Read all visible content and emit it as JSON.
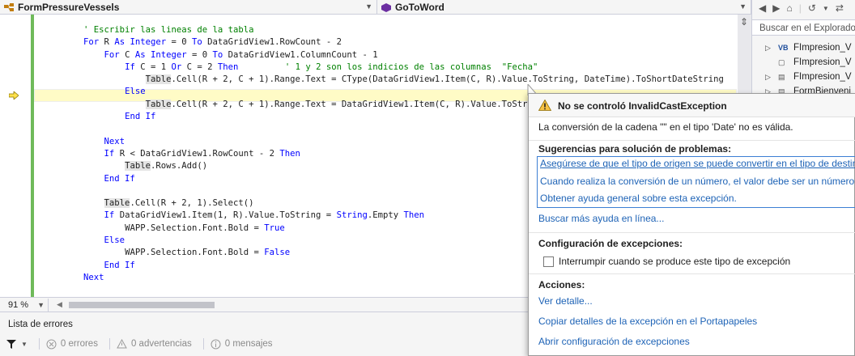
{
  "navbar": {
    "left_combo": "FormPressureVessels",
    "right_combo": "GoToWord"
  },
  "code_lines": [
    [
      {
        "t": "        "
      },
      {
        "t": "' Escribir las lineas de la tabla",
        "c": "cm"
      }
    ],
    [
      {
        "t": "        "
      },
      {
        "t": "For",
        "c": "kw"
      },
      {
        "t": " R "
      },
      {
        "t": "As",
        "c": "kw"
      },
      {
        "t": " "
      },
      {
        "t": "Integer",
        "c": "kw"
      },
      {
        "t": " = 0 "
      },
      {
        "t": "To",
        "c": "kw"
      },
      {
        "t": " DataGridView1.RowCount - 2"
      }
    ],
    [
      {
        "t": "            "
      },
      {
        "t": "For",
        "c": "kw"
      },
      {
        "t": " C "
      },
      {
        "t": "As",
        "c": "kw"
      },
      {
        "t": " "
      },
      {
        "t": "Integer",
        "c": "kw"
      },
      {
        "t": " = 0 "
      },
      {
        "t": "To",
        "c": "kw"
      },
      {
        "t": " DataGridView1.ColumnCount - 1"
      }
    ],
    [
      {
        "t": "                "
      },
      {
        "t": "If",
        "c": "kw"
      },
      {
        "t": " C = 1 "
      },
      {
        "t": "Or",
        "c": "kw"
      },
      {
        "t": " C = 2 "
      },
      {
        "t": "Then",
        "c": "kw"
      },
      {
        "t": "         "
      },
      {
        "t": "' 1 y 2 son los indicios de las columnas  \"Fecha\"",
        "c": "cm"
      }
    ],
    [
      {
        "t": "                    "
      },
      {
        "t": "Table",
        "c": "hl"
      },
      {
        "t": ".Cell(R + 2, C + 1).Range.Text = CType(DataGridView1.Item(C, R).Value.ToString, DateTime).ToShortDateString"
      }
    ],
    [
      {
        "t": "                "
      },
      {
        "t": "Else",
        "c": "kw"
      }
    ],
    [
      {
        "t": "                    "
      },
      {
        "t": "Table",
        "c": "hl"
      },
      {
        "t": ".Cell(R + 2, C + 1).Range.Text = DataGridView1.Item(C, R).Value.ToStr"
      }
    ],
    [
      {
        "t": "                "
      },
      {
        "t": "End If",
        "c": "kw"
      }
    ],
    [
      {
        "t": ""
      }
    ],
    [
      {
        "t": "            "
      },
      {
        "t": "Next",
        "c": "kw"
      }
    ],
    [
      {
        "t": "            "
      },
      {
        "t": "If",
        "c": "kw"
      },
      {
        "t": " R < DataGridView1.RowCount - 2 "
      },
      {
        "t": "Then",
        "c": "kw"
      }
    ],
    [
      {
        "t": "                "
      },
      {
        "t": "Table",
        "c": "hl"
      },
      {
        "t": ".Rows.Add()"
      }
    ],
    [
      {
        "t": "            "
      },
      {
        "t": "End If",
        "c": "kw"
      }
    ],
    [
      {
        "t": ""
      }
    ],
    [
      {
        "t": "            "
      },
      {
        "t": "Table",
        "c": "hl"
      },
      {
        "t": ".Cell(R + 2, 1).Select()"
      }
    ],
    [
      {
        "t": "            "
      },
      {
        "t": "If",
        "c": "kw"
      },
      {
        "t": " DataGridView1.Item(1, R).Value.ToString = "
      },
      {
        "t": "String",
        "c": "kw"
      },
      {
        "t": ".Empty "
      },
      {
        "t": "Then",
        "c": "kw"
      }
    ],
    [
      {
        "t": "                "
      },
      {
        "t": "WAPP.Selection.Font.Bold = "
      },
      {
        "t": "True",
        "c": "kw"
      }
    ],
    [
      {
        "t": "            "
      },
      {
        "t": "Else",
        "c": "kw"
      }
    ],
    [
      {
        "t": "                "
      },
      {
        "t": "WAPP.Selection.Font.Bold = "
      },
      {
        "t": "False",
        "c": "kw"
      }
    ],
    [
      {
        "t": "            "
      },
      {
        "t": "End If",
        "c": "kw"
      }
    ],
    [
      {
        "t": "        "
      },
      {
        "t": "Next",
        "c": "kw"
      }
    ]
  ],
  "zoom": "91 %",
  "error_list": {
    "title": "Lista de errores",
    "errors": "0 errores",
    "warnings": "0 advertencias",
    "messages": "0 mensajes"
  },
  "solution": {
    "search_placeholder": "Buscar en el Explorado",
    "items": [
      "FImpresion_V",
      "FImpresion_V",
      "FImpresion_V",
      "FormBienveni"
    ],
    "vb_badge": "VB"
  },
  "exception": {
    "title": "No se controló InvalidCastException",
    "message": "La conversión de la cadena \"\" en el tipo 'Date' no es válida.",
    "suggestions_header": "Sugerencias para solución de problemas:",
    "suggestions": [
      "Asegúrese de que el tipo de origen se puede convertir en el tipo de destino",
      "Cuando realiza la conversión de un número, el valor debe ser un número r",
      "Obtener ayuda general sobre esta excepción."
    ],
    "more_help": "Buscar más ayuda en línea...",
    "config_header": "Configuración de excepciones:",
    "checkbox_label": "Interrumpir cuando se produce este tipo de excepción",
    "actions_header": "Acciones:",
    "actions": [
      "Ver detalle...",
      "Copiar detalles de la excepción en el Portapapeles",
      "Abrir configuración de excepciones"
    ]
  },
  "colors": {
    "keyword": "#0000ff",
    "comment": "#008000",
    "link": "#1e63b6",
    "current_line": "#fffbc6",
    "change_bar": "#6fba5a"
  }
}
